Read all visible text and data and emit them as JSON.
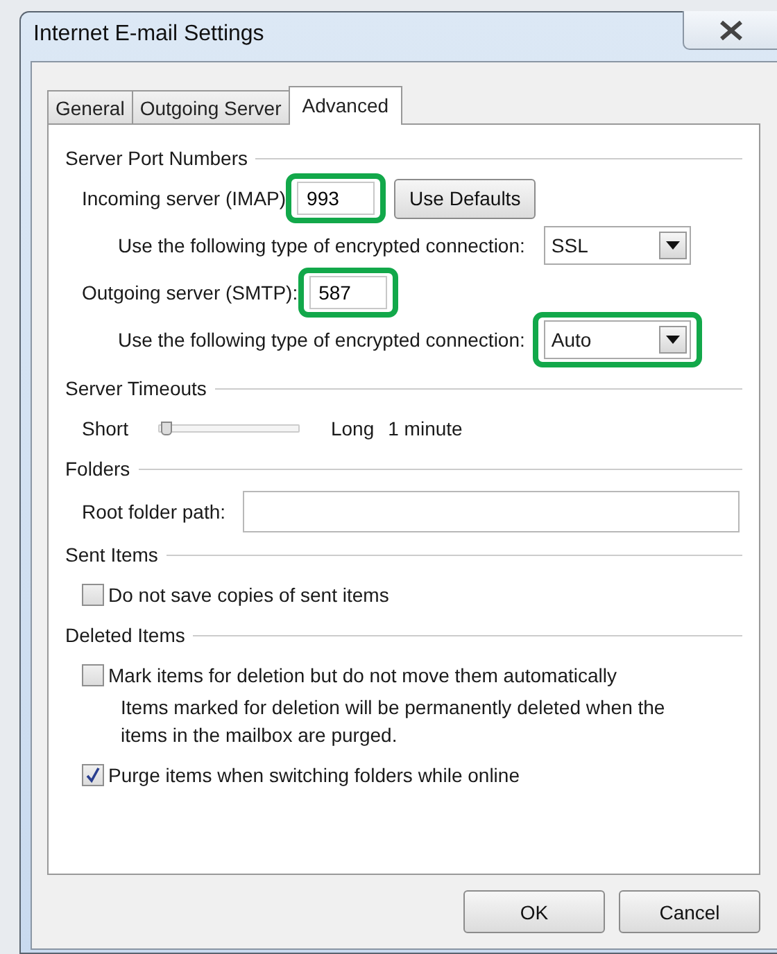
{
  "window": {
    "title": "Internet E-mail Settings"
  },
  "tabs": [
    {
      "label": "General",
      "selected": false
    },
    {
      "label": "Outgoing Server",
      "selected": false
    },
    {
      "label": "Advanced",
      "selected": true
    }
  ],
  "server_ports": {
    "heading": "Server Port Numbers",
    "incoming": {
      "label": "Incoming server (IMAP)",
      "value": "993",
      "highlighted": true
    },
    "use_defaults_button": "Use Defaults",
    "incoming_encryption": {
      "label": "Use the following type of encrypted connection:",
      "value": "SSL",
      "highlighted": false
    },
    "outgoing": {
      "label": "Outgoing server (SMTP):",
      "value": "587",
      "highlighted": true
    },
    "outgoing_encryption": {
      "label": "Use the following type of encrypted connection:",
      "value": "Auto",
      "highlighted": true
    }
  },
  "server_timeouts": {
    "heading": "Server Timeouts",
    "min_label": "Short",
    "max_label": "Long",
    "level": 0.05,
    "reading": "1 minute"
  },
  "folders": {
    "heading": "Folders",
    "root_folder_label": "Root folder path:"
  },
  "sent_items": {
    "heading": "Sent Items",
    "options": [
      {
        "label": "Do not save copies of sent items",
        "checked": false
      }
    ]
  },
  "deleted_items": {
    "heading": "Deleted Items",
    "options": [
      {
        "label": "Mark items for deletion but do not move them automatically",
        "checked": false,
        "note": "Items marked for deletion will be permanently deleted when the items in the mailbox are purged."
      },
      {
        "label": "Purge items when switching folders while online",
        "checked": true
      }
    ]
  },
  "buttons": [
    {
      "label": "OK"
    },
    {
      "label": "Cancel"
    }
  ]
}
